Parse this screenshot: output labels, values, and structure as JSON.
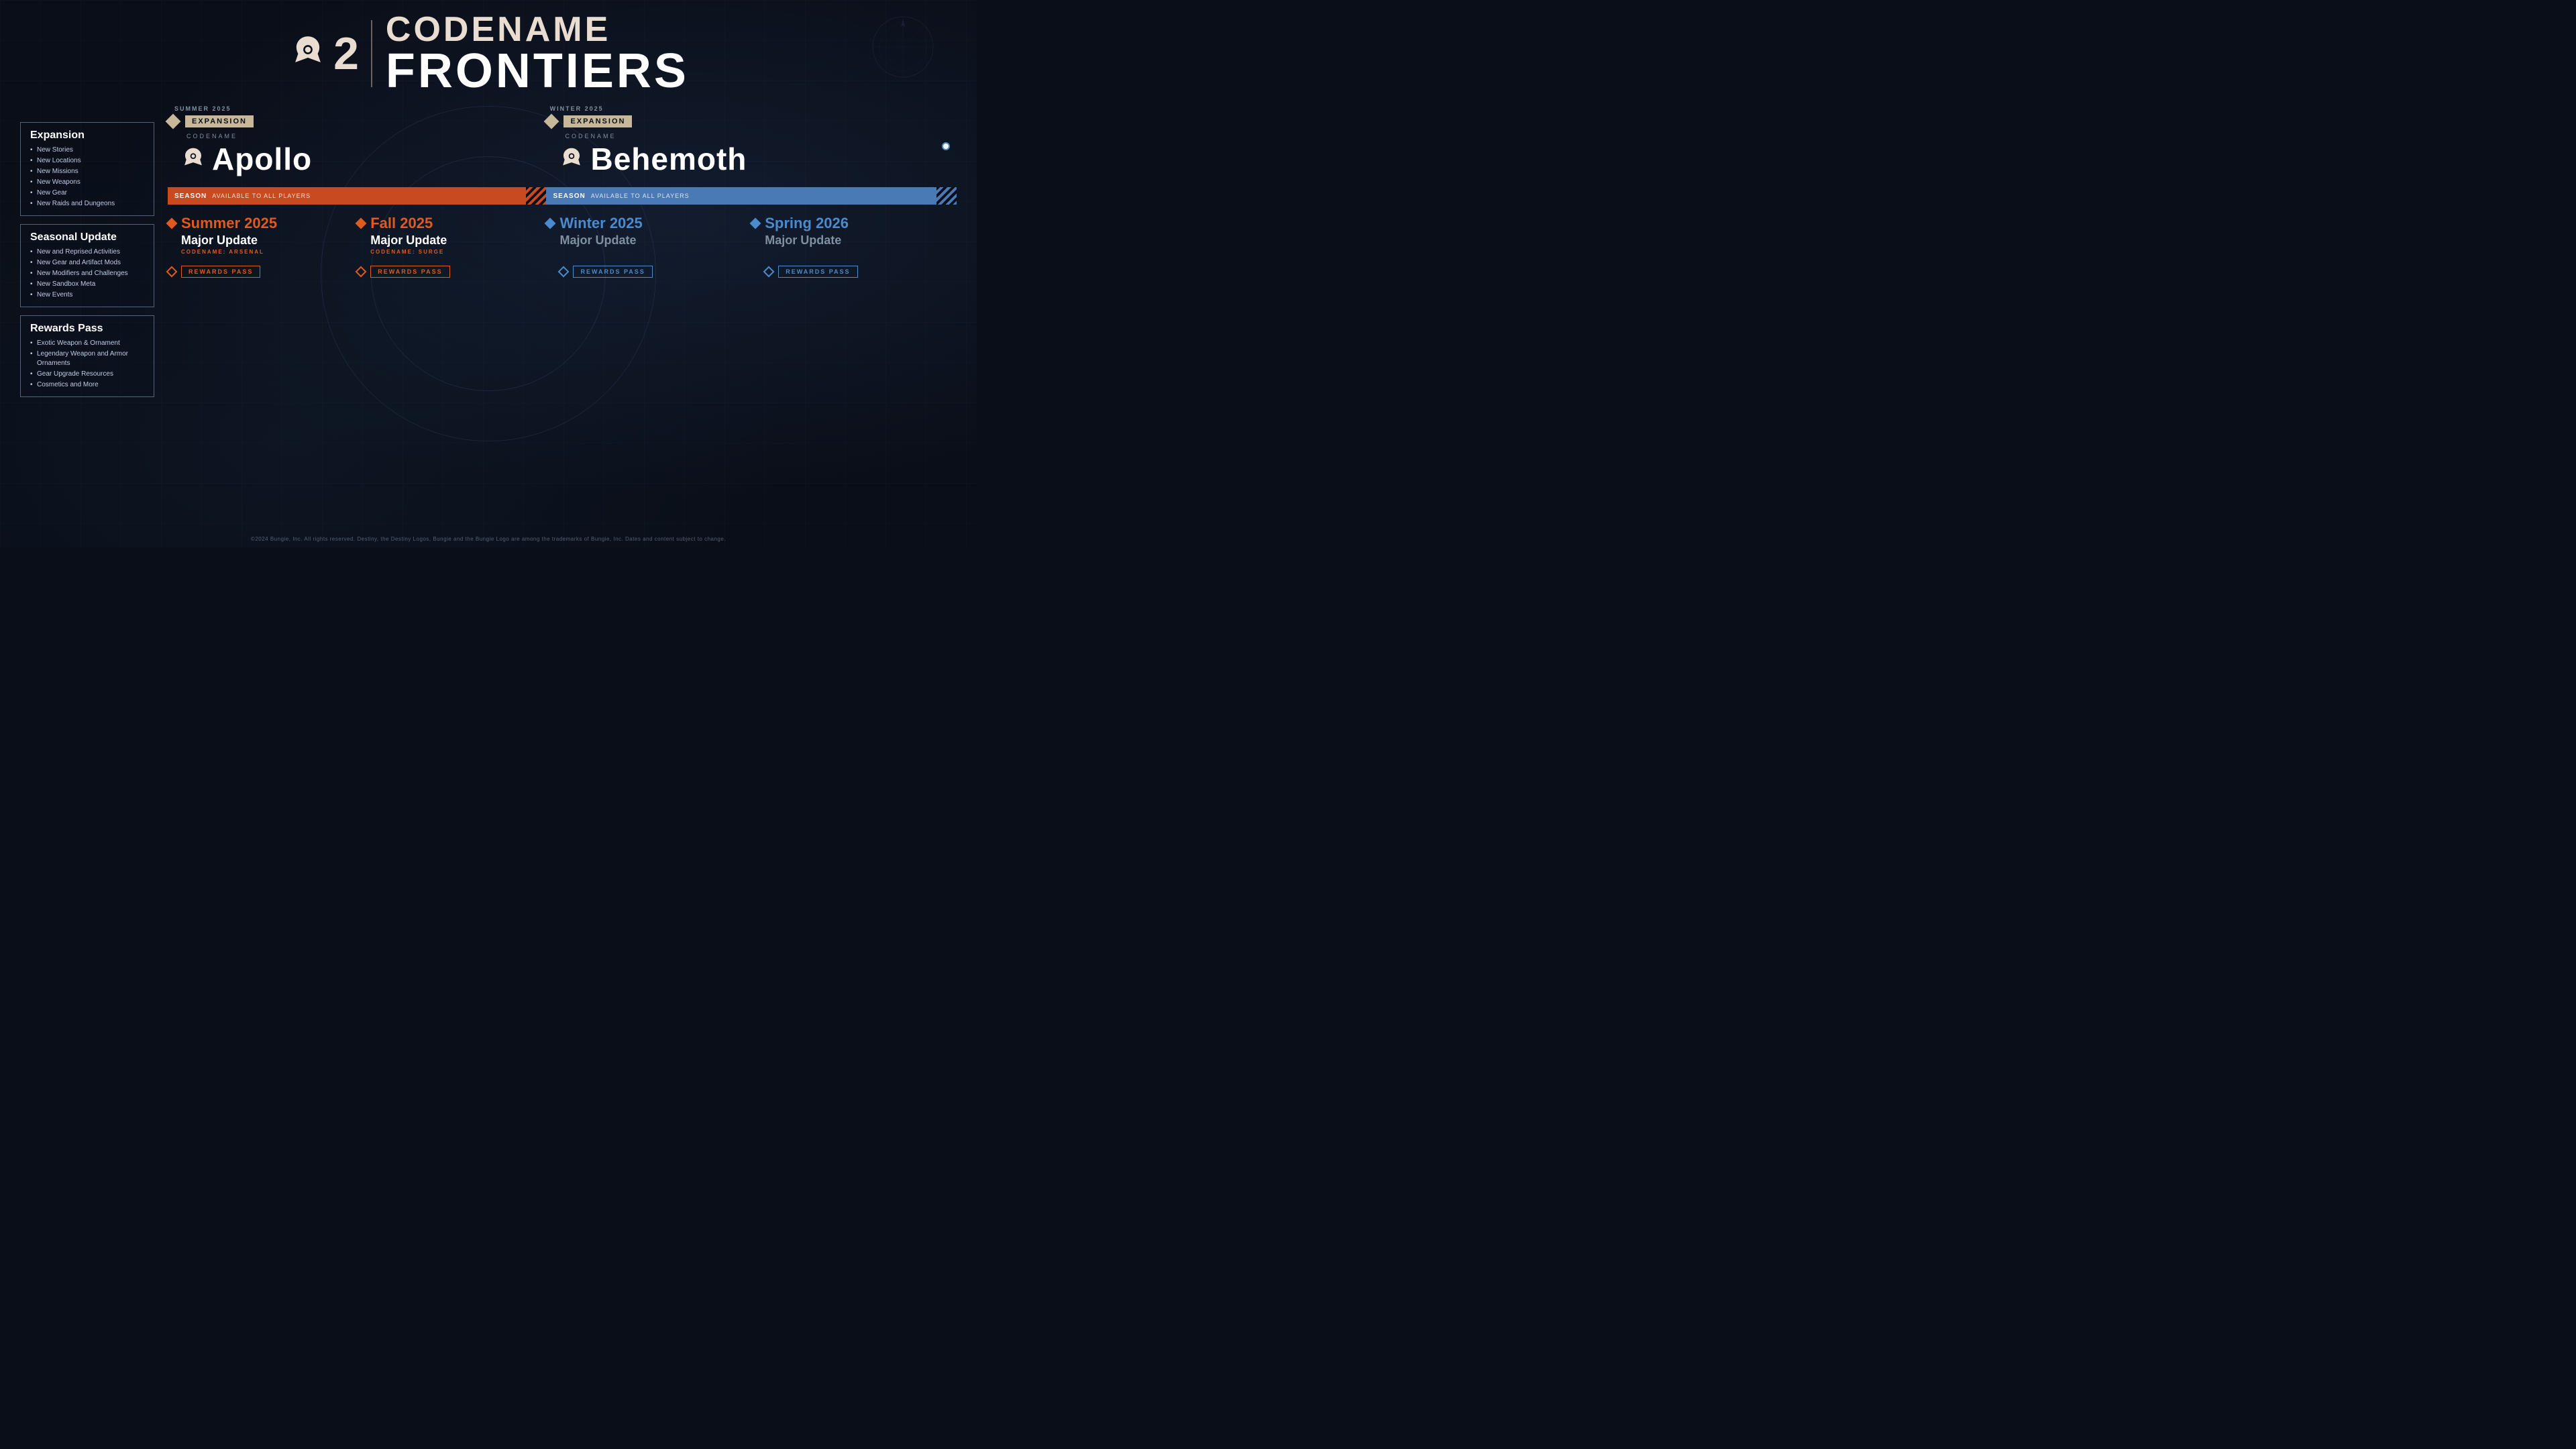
{
  "header": {
    "codename": "CODENAME",
    "frontiers": "FRONTIERS",
    "d2": "2"
  },
  "legend": {
    "expansion": {
      "title": "Expansion",
      "items": [
        "New Stories",
        "New Locations",
        "New Missions",
        "New Weapons",
        "New Gear",
        "New Raids and Dungeons"
      ]
    },
    "seasonal": {
      "title": "Seasonal Update",
      "items": [
        "New and Reprised Activities",
        "New Gear and Artifact Mods",
        "New Modifiers and Challenges",
        "New Sandbox Meta",
        "New Events"
      ]
    },
    "rewards": {
      "title": "Rewards Pass",
      "items": [
        "Exotic Weapon & Ornament",
        "Legendary Weapon and Armor Ornaments",
        "Gear Upgrade Resources",
        "Cosmetics and More"
      ]
    }
  },
  "timeline": {
    "season_summer": "SUMMER 2025",
    "season_winter": "WINTER 2025",
    "expansion_summer": {
      "tag": "EXPANSION",
      "codename_label": "CODENAME",
      "name": "Apollo"
    },
    "expansion_winter": {
      "tag": "EXPANSION",
      "codename_label": "CODENAME",
      "name": "Behemoth"
    },
    "band_summer": {
      "season_word": "SEASON",
      "available": "AVAILABLE TO ALL PLAYERS"
    },
    "band_winter": {
      "season_word": "SEASON",
      "available": "AVAILABLE TO ALL PLAYERS"
    },
    "update_summer1": {
      "season_year": "Summer 2025",
      "major": "Major Update",
      "codename": "CODENAME: ARSENAL"
    },
    "update_summer2": {
      "season_year": "Fall 2025",
      "major": "Major Update",
      "codename": "CODENAME: SURGE"
    },
    "update_winter1": {
      "season_year": "Winter 2025",
      "major": "Major Update",
      "codename": ""
    },
    "update_winter2": {
      "season_year": "Spring 2026",
      "major": "Major Update",
      "codename": ""
    },
    "rewards_pass": "REWARDS PASS"
  },
  "footer": {
    "text": "©2024 Bungie, Inc. All rights reserved. Destiny, the Destiny Logos, Bungie and the Bungie Logo are among the trademarks of Bungie, Inc. Dates and content subject to change."
  }
}
